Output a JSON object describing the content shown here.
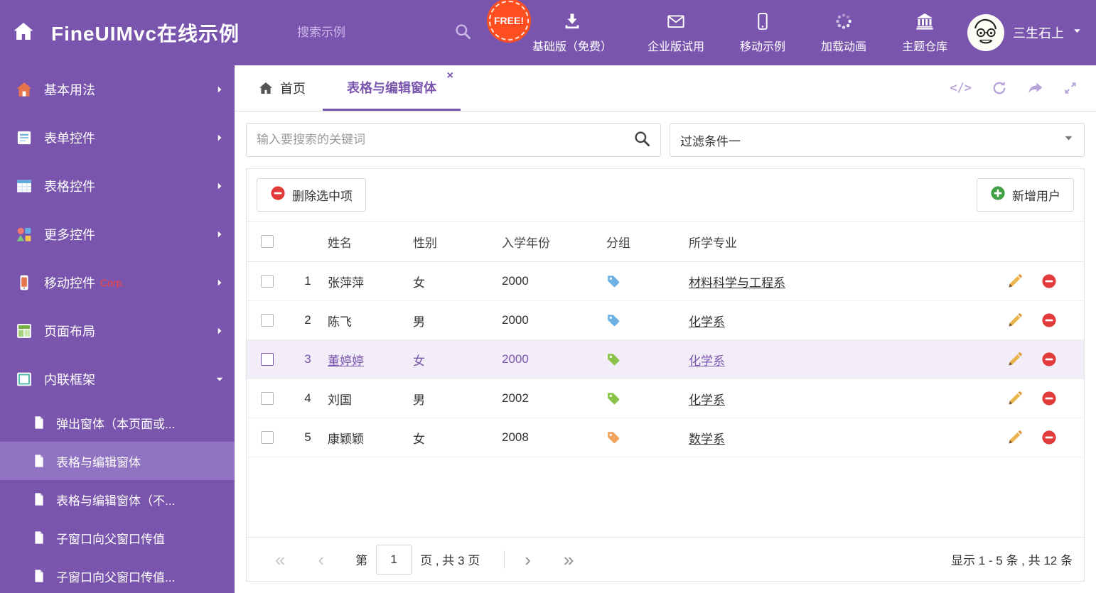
{
  "header": {
    "title": "FineUIMvc在线示例",
    "search_placeholder": "搜索示例",
    "free_badge": "FREE!",
    "nav": [
      {
        "id": "basic-free",
        "svg": "download",
        "icon": "download-icon",
        "label": "基础版（免费）"
      },
      {
        "id": "enterprise-trial",
        "svg": "envelope",
        "icon": "envelope-icon",
        "label": "企业版试用"
      },
      {
        "id": "mobile-demo",
        "svg": "mobile",
        "icon": "mobile-icon",
        "label": "移动示例"
      },
      {
        "id": "loading-animation",
        "svg": "spinner",
        "icon": "spinner-icon",
        "label": "加载动画"
      },
      {
        "id": "theme-repo",
        "svg": "bank",
        "icon": "bank-icon",
        "label": "主题仓库"
      }
    ],
    "user_name": "三生石上"
  },
  "sidebar": {
    "items": [
      {
        "id": "basic-usage",
        "svg": "house",
        "icon": "house-icon",
        "label": "基本用法",
        "state": "collapsed"
      },
      {
        "id": "form-controls",
        "svg": "form",
        "icon": "form-icon",
        "label": "表单控件",
        "state": "collapsed"
      },
      {
        "id": "grid-controls",
        "svg": "grid",
        "icon": "grid-icon",
        "label": "表格控件",
        "state": "collapsed"
      },
      {
        "id": "more-controls",
        "svg": "shapes",
        "icon": "shapes-icon",
        "label": "更多控件",
        "state": "collapsed"
      },
      {
        "id": "mobile-controls",
        "svg": "phone",
        "icon": "phone-icon",
        "label": "移动控件",
        "badge": "Corp.",
        "state": "collapsed"
      },
      {
        "id": "page-layout",
        "svg": "layout",
        "icon": "layout-icon",
        "label": "页面布局",
        "state": "collapsed"
      },
      {
        "id": "inline-frame",
        "svg": "frame",
        "icon": "frame-icon",
        "label": "内联框架",
        "state": "expanded"
      }
    ],
    "subitems": [
      {
        "id": "popup-window",
        "label": "弹出窗体（本页面或...",
        "active": false
      },
      {
        "id": "grid-edit-window",
        "label": "表格与编辑窗体",
        "active": true
      },
      {
        "id": "grid-edit-window-no",
        "label": "表格与编辑窗体（不...",
        "active": false
      },
      {
        "id": "child-to-parent",
        "label": "子窗口向父窗口传值",
        "active": false
      },
      {
        "id": "child-to-parent-2",
        "label": "子窗口向父窗口传值...",
        "active": false
      }
    ]
  },
  "tabs": {
    "home_label": "首页",
    "active_label": "表格与编辑窗体",
    "close_glyph": "×"
  },
  "tab_tools": {
    "code_label": "</>"
  },
  "filters": {
    "search_placeholder": "输入要搜索的关键词",
    "filter_selected": "过滤条件一"
  },
  "actions": {
    "delete_selected_label": "删除选中项",
    "add_user_label": "新增用户"
  },
  "table": {
    "headers": {
      "name": "姓名",
      "gender": "性别",
      "year": "入学年份",
      "group": "分组",
      "major": "所学专业"
    },
    "rows": [
      {
        "num": "1",
        "name": "张萍萍",
        "gender": "女",
        "year": "2000",
        "tag_color": "#6db1e4",
        "major": "材料科学与工程系",
        "selected": false
      },
      {
        "num": "2",
        "name": "陈飞",
        "gender": "男",
        "year": "2000",
        "tag_color": "#6db1e4",
        "major": "化学系",
        "selected": false
      },
      {
        "num": "3",
        "name": "董婷婷",
        "gender": "女",
        "year": "2000",
        "tag_color": "#8bc34a",
        "major": "化学系",
        "selected": true
      },
      {
        "num": "4",
        "name": "刘国",
        "gender": "男",
        "year": "2002",
        "tag_color": "#8bc34a",
        "major": "化学系",
        "selected": false
      },
      {
        "num": "5",
        "name": "康颖颖",
        "gender": "女",
        "year": "2008",
        "tag_color": "#f0a45e",
        "major": "数学系",
        "selected": false
      }
    ]
  },
  "pagination": {
    "first": "«",
    "prev": "‹",
    "page_prefix": "第",
    "page_value": "1",
    "page_suffix": "页 , 共 3 页",
    "next": "›",
    "last": "»",
    "summary": "显示 1 - 5 条 , 共 12 条"
  },
  "colors": {
    "primary": "#7a55ad",
    "sidebar_active": "#9173c3",
    "selected_row_bg": "#f2edf9",
    "free_badge_bg": "#ff4e1f",
    "delete_red": "#e23b3b",
    "add_green": "#43a047",
    "pencil_gold": "#eab54e"
  }
}
